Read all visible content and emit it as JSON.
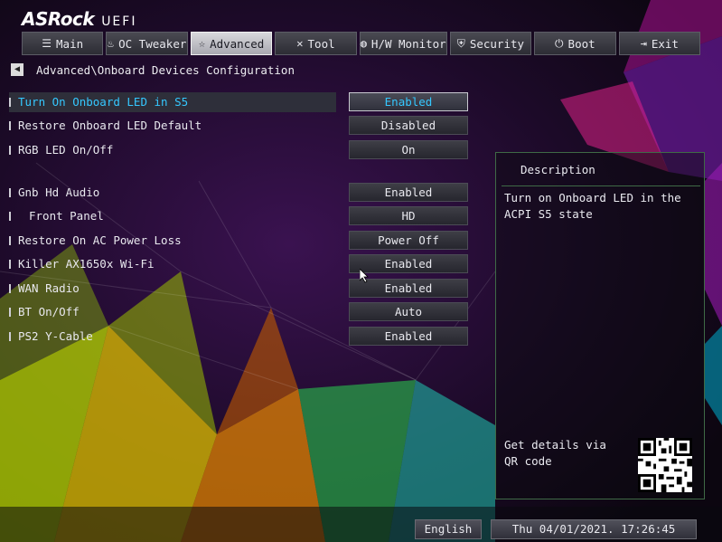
{
  "brand": {
    "logo": "ASRock",
    "suffix": "UEFI"
  },
  "tabs": [
    {
      "label": "Main",
      "icon": "list-icon"
    },
    {
      "label": "OC Tweaker",
      "icon": "flame-icon"
    },
    {
      "label": "Advanced",
      "icon": "star-icon",
      "active": true
    },
    {
      "label": "Tool",
      "icon": "wrench-icon"
    },
    {
      "label": "H/W Monitor",
      "icon": "globe-icon"
    },
    {
      "label": "Security",
      "icon": "shield-icon"
    },
    {
      "label": "Boot",
      "icon": "power-icon"
    },
    {
      "label": "Exit",
      "icon": "exit-icon"
    }
  ],
  "breadcrumb": "Advanced\\Onboard Devices Configuration",
  "settings": [
    {
      "label": "Turn On Onboard LED in S5",
      "value": "Enabled",
      "selected": true
    },
    {
      "label": "Restore Onboard LED Default",
      "value": "Disabled"
    },
    {
      "label": "RGB LED On/Off",
      "value": "On"
    },
    {
      "label": "Gnb Hd Audio",
      "value": "Enabled"
    },
    {
      "label": "Front Panel",
      "value": "HD"
    },
    {
      "label": "Restore On AC Power Loss",
      "value": "Power Off"
    },
    {
      "label": "Killer AX1650x Wi-Fi",
      "value": "Enabled"
    },
    {
      "label": "WAN Radio",
      "value": "Enabled"
    },
    {
      "label": "BT On/Off",
      "value": "Auto"
    },
    {
      "label": "PS2 Y-Cable",
      "value": "Enabled"
    }
  ],
  "description": {
    "title": "Description",
    "text": "Turn on Onboard LED in the ACPI S5 state",
    "qr_text": "Get details via QR code"
  },
  "footer": {
    "language": "English",
    "datetime": "Thu 04/01/2021. 17:26:45"
  },
  "colors": {
    "accent": "#35c8ff",
    "panel_border": "#3f6a46",
    "background": "#120818"
  }
}
